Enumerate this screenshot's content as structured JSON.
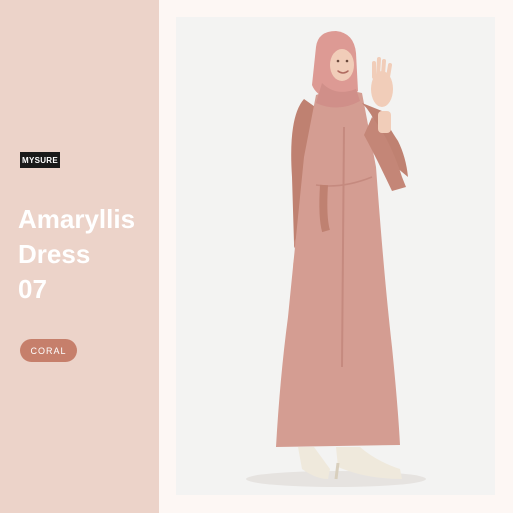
{
  "brand": {
    "logo_text": "MYSURE"
  },
  "product": {
    "title_lines": [
      "Amaryllis",
      "Dress",
      "07"
    ],
    "color_label": "CORAL"
  },
  "colors": {
    "left_panel": "#ecd3c9",
    "badge": "#c67f6b",
    "dress": "#d49d92",
    "sleeve": "#bf8171",
    "hijab": "#dd9a94"
  },
  "photo": {
    "subject": "model-wearing-dress"
  }
}
